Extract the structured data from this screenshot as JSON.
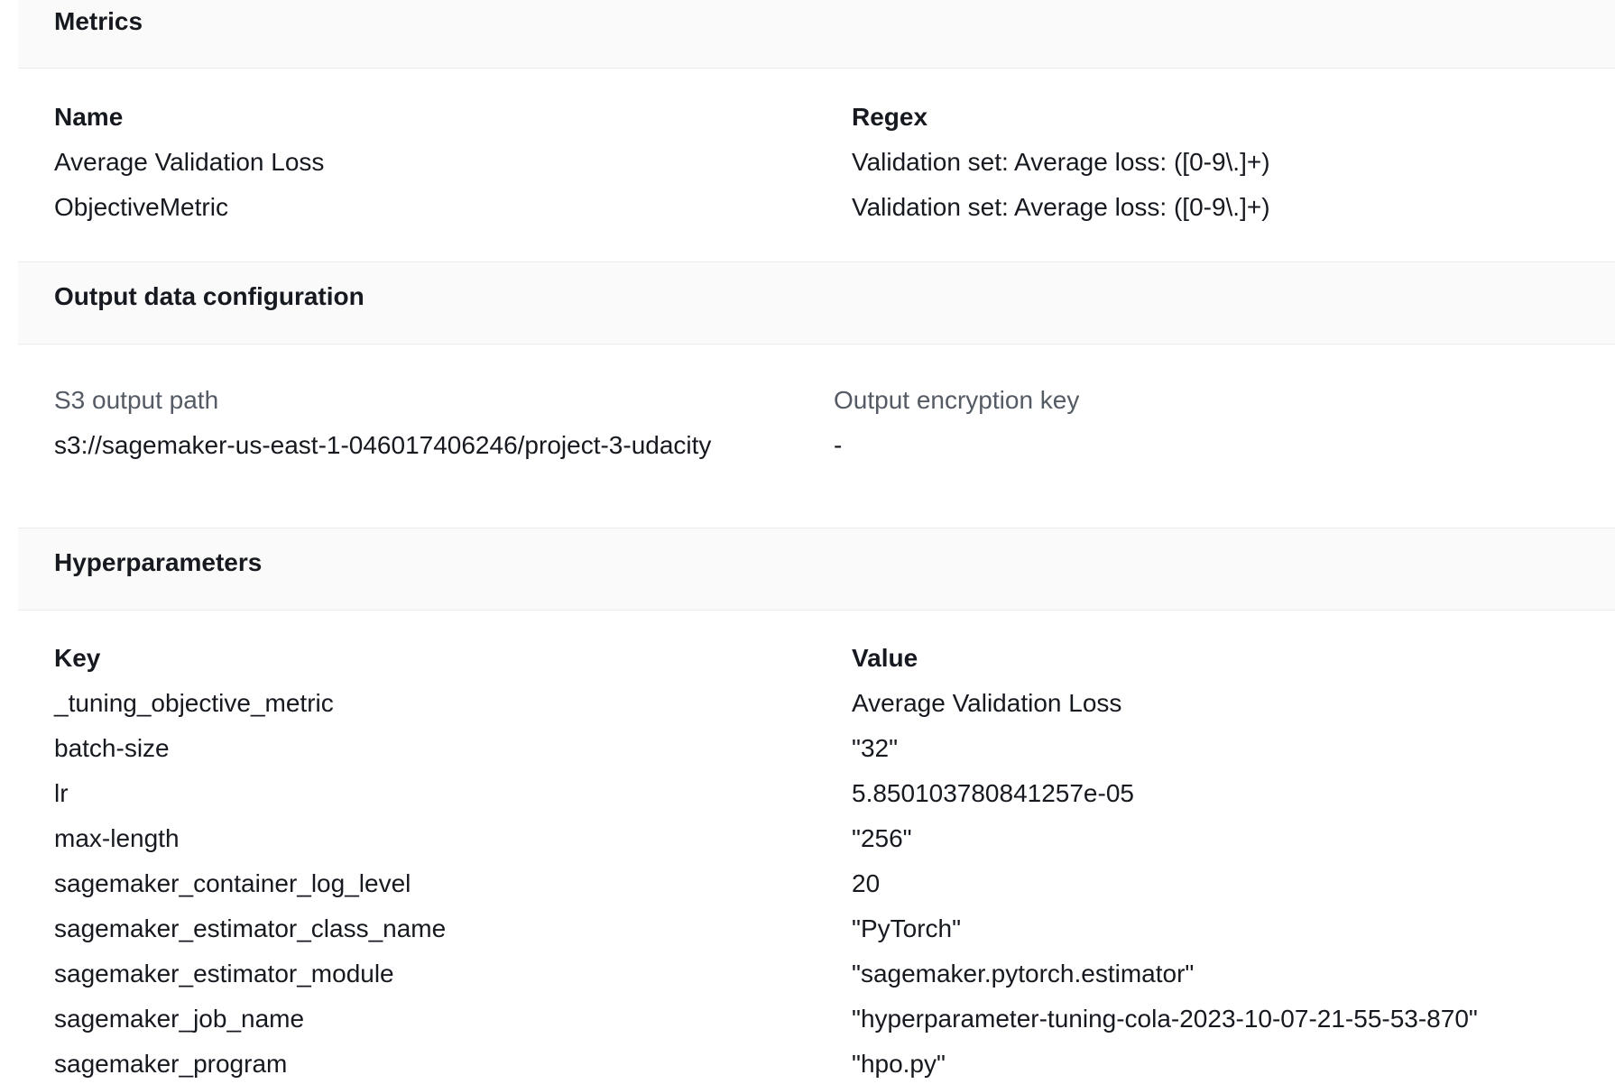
{
  "metrics": {
    "title": "Metrics",
    "col_name": "Name",
    "col_regex": "Regex",
    "rows": [
      {
        "name": "Average Validation Loss",
        "regex": "Validation set: Average loss: ([0-9\\.]+)"
      },
      {
        "name": "ObjectiveMetric",
        "regex": "Validation set: Average loss: ([0-9\\.]+)"
      }
    ]
  },
  "output": {
    "title": "Output data configuration",
    "s3_label": "S3 output path",
    "s3_value": "s3://sagemaker-us-east-1-046017406246/project-3-udacity",
    "enc_label": "Output encryption key",
    "enc_value": "-"
  },
  "hyper": {
    "title": "Hyperparameters",
    "col_key": "Key",
    "col_value": "Value",
    "rows": [
      {
        "key": "_tuning_objective_metric",
        "value": "Average Validation Loss"
      },
      {
        "key": "batch-size",
        "value": "\"32\""
      },
      {
        "key": "lr",
        "value": "5.850103780841257e-05"
      },
      {
        "key": "max-length",
        "value": "\"256\""
      },
      {
        "key": "sagemaker_container_log_level",
        "value": "20"
      },
      {
        "key": "sagemaker_estimator_class_name",
        "value": "\"PyTorch\""
      },
      {
        "key": "sagemaker_estimator_module",
        "value": "\"sagemaker.pytorch.estimator\""
      },
      {
        "key": "sagemaker_job_name",
        "value": "\"hyperparameter-tuning-cola-2023-10-07-21-55-53-870\""
      },
      {
        "key": "sagemaker_program",
        "value": "\"hpo.py\""
      }
    ]
  }
}
